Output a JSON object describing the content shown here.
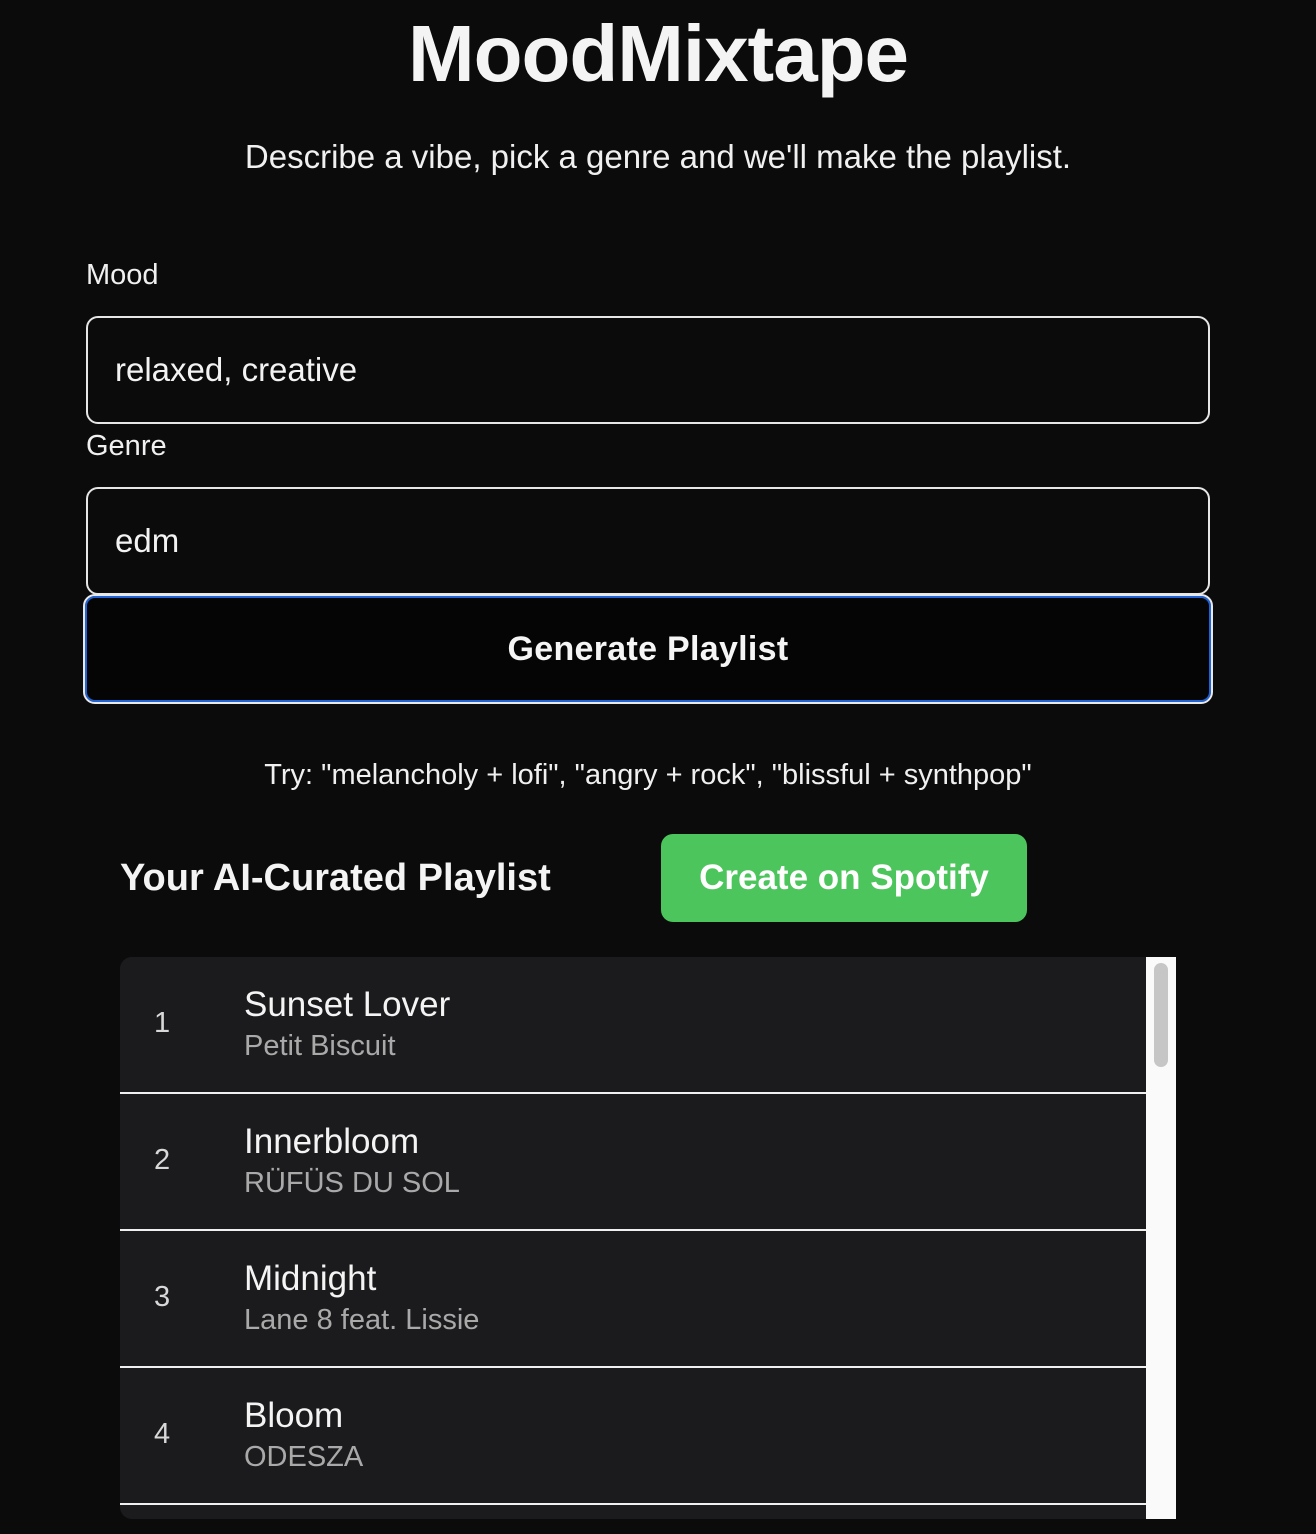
{
  "app": {
    "title": "MoodMixtape",
    "subtitle": "Describe a vibe, pick a genre and we'll make the playlist."
  },
  "form": {
    "mood_label": "Mood",
    "mood_value": "relaxed, creative",
    "genre_label": "Genre",
    "genre_value": "edm",
    "generate_label": "Generate Playlist",
    "hint": "Try: \"melancholy + lofi\", \"angry + rock\", \"blissful + synthpop\""
  },
  "playlist": {
    "heading": "Your AI-Curated Playlist",
    "spotify_label": "Create on Spotify",
    "spotify_color": "#4cc55c",
    "tracks": [
      {
        "num": "1",
        "title": "Sunset Lover",
        "artist": "Petit Biscuit"
      },
      {
        "num": "2",
        "title": "Innerbloom",
        "artist": "RÜFÜS DU SOL"
      },
      {
        "num": "3",
        "title": "Midnight",
        "artist": "Lane 8 feat. Lissie"
      },
      {
        "num": "4",
        "title": "Bloom",
        "artist": "ODESZA"
      }
    ]
  },
  "colors": {
    "background": "#0b0b0c",
    "focus_ring": "#1f63d6",
    "list_background": "#1b1b1d"
  }
}
